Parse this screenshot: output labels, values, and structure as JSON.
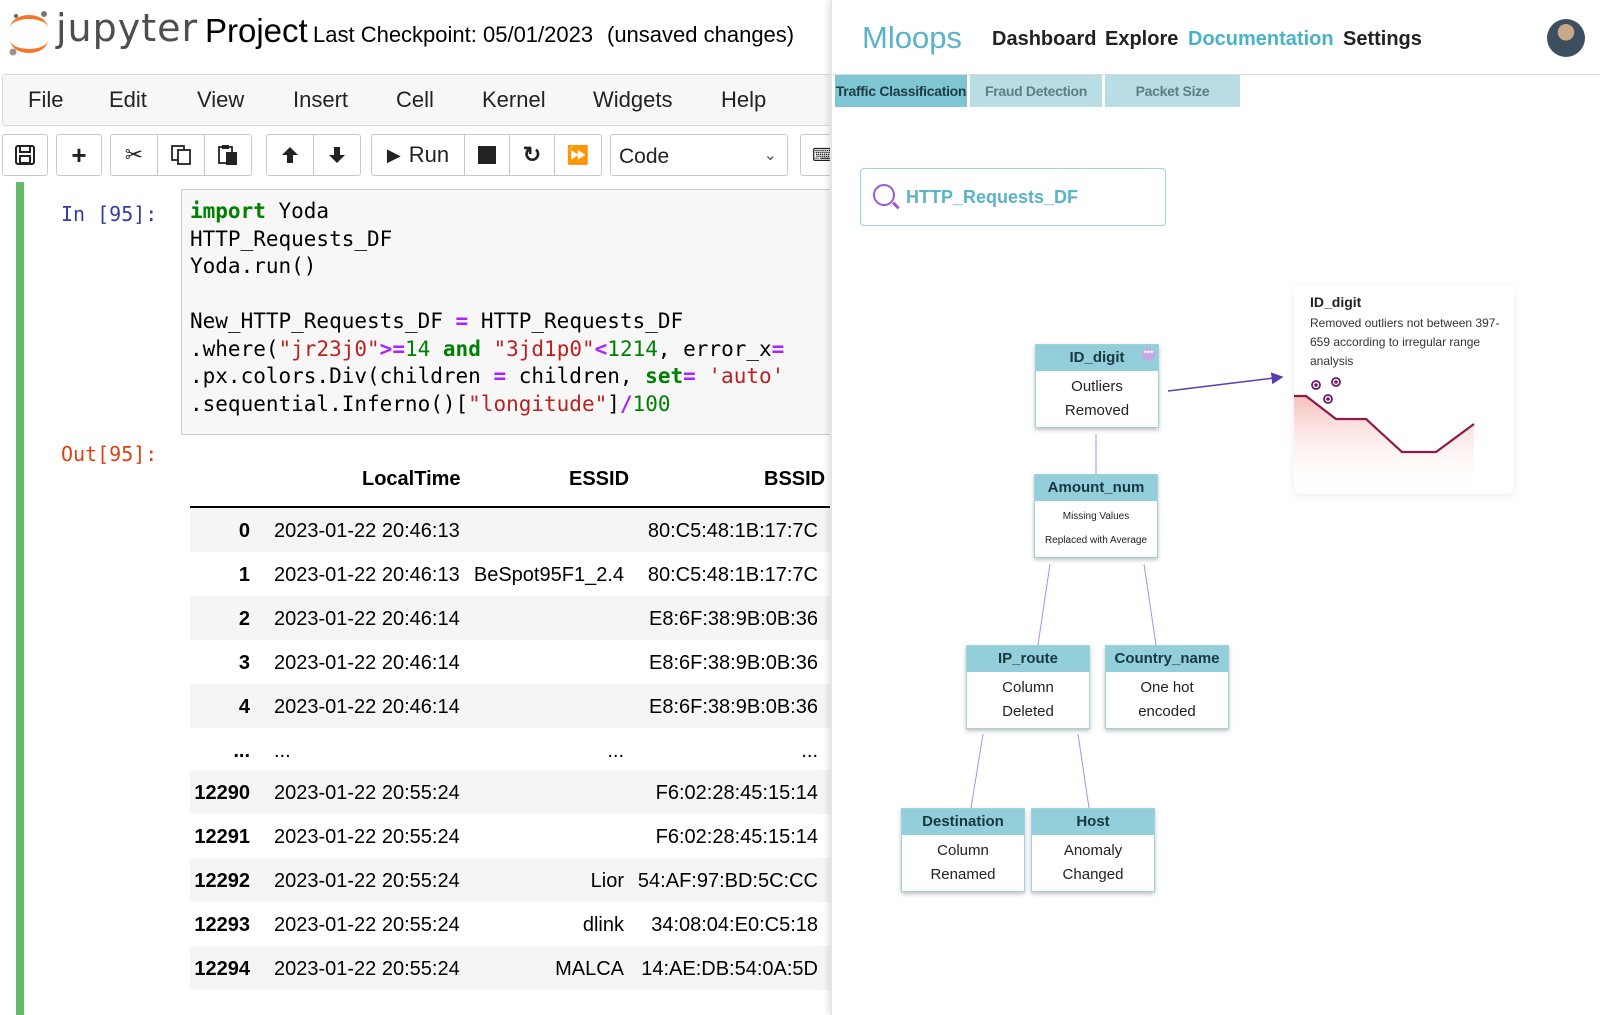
{
  "jupyter": {
    "logo_text": "jupyter",
    "notebook_title": "Project",
    "checkpoint": "Last Checkpoint: 05/01/2023",
    "unsaved": "(unsaved changes)",
    "menu": [
      "File",
      "Edit",
      "View",
      "Insert",
      "Cell",
      "Kernel",
      "Widgets",
      "Help"
    ],
    "toolbar": {
      "run_label": "Run",
      "cell_type": "Code"
    },
    "cell": {
      "in_prompt": "In [95]:",
      "out_prompt": "Out[95]:",
      "code": {
        "l1_kw": "import",
        "l1_rest": " Yoda",
        "l2": "HTTP_Requests_DF",
        "l3": "Yoda.run()",
        "l5_a": "New_HTTP_Requests_DF ",
        "l5_op": "=",
        "l5_b": " HTTP_Requests_DF",
        "l6_a": ".where(",
        "l6_s1": "\"jr23j0\"",
        "l6_op1": ">=",
        "l6_n1": "14",
        "l6_kw": " and ",
        "l6_s2": "\"3jd1p0\"",
        "l6_op2": "<",
        "l6_n2": "1214",
        "l6_b": ", error_x",
        "l6_op3": "=",
        "l7_a": ".px.colors.Div(children ",
        "l7_op1": "=",
        "l7_b": " children, ",
        "l7_kw": "set",
        "l7_op2": "=",
        "l7_s": " 'auto'",
        "l8_a": ".sequential.Inferno()[",
        "l8_s": "\"longitude\"",
        "l8_b": "]",
        "l8_op": "/",
        "l8_n": "100"
      }
    },
    "table": {
      "columns": [
        "LocalTime",
        "ESSID",
        "BSSID"
      ],
      "rows": [
        {
          "idx": "0",
          "time": "2023-01-22 20:46:13",
          "essid": "",
          "bssid": "80:C5:48:1B:17:7C"
        },
        {
          "idx": "1",
          "time": "2023-01-22 20:46:13",
          "essid": "BeSpot95F1_2.4",
          "bssid": "80:C5:48:1B:17:7C"
        },
        {
          "idx": "2",
          "time": "2023-01-22 20:46:14",
          "essid": "",
          "bssid": "E8:6F:38:9B:0B:36"
        },
        {
          "idx": "3",
          "time": "2023-01-22 20:46:14",
          "essid": "",
          "bssid": "E8:6F:38:9B:0B:36"
        },
        {
          "idx": "4",
          "time": "2023-01-22 20:46:14",
          "essid": "",
          "bssid": "E8:6F:38:9B:0B:36"
        },
        {
          "idx": "...",
          "time": "...",
          "essid": "...",
          "bssid": "..."
        },
        {
          "idx": "12290",
          "time": "2023-01-22 20:55:24",
          "essid": "",
          "bssid": "F6:02:28:45:15:14"
        },
        {
          "idx": "12291",
          "time": "2023-01-22 20:55:24",
          "essid": "",
          "bssid": "F6:02:28:45:15:14"
        },
        {
          "idx": "12292",
          "time": "2023-01-22 20:55:24",
          "essid": "Lior",
          "bssid": "54:AF:97:BD:5C:CC"
        },
        {
          "idx": "12293",
          "time": "2023-01-22 20:55:24",
          "essid": "dlink",
          "bssid": "34:08:04:E0:C5:18"
        },
        {
          "idx": "12294",
          "time": "2023-01-22 20:55:24",
          "essid": "MALCA",
          "bssid": "14:AE:DB:54:0A:5D"
        }
      ]
    }
  },
  "mloops": {
    "logo": "Mloops",
    "nav": [
      "Dashboard",
      "Explore",
      "Documentation",
      "Settings"
    ],
    "active_nav": "Documentation",
    "tabs": [
      "Traffic Classification",
      "Fraud Detection",
      "Packet Size"
    ],
    "active_tab": "Traffic Classification",
    "search_value": "HTTP_Requests_DF",
    "nodes": {
      "id_digit": {
        "title": "ID_digit",
        "l1": "Outliers",
        "l2": "Removed"
      },
      "amount_num": {
        "title": "Amount_num",
        "l1": "Missing Values",
        "l2": "Replaced with Average"
      },
      "ip_route": {
        "title": "IP_route",
        "l1": "Column",
        "l2": "Deleted"
      },
      "country_name": {
        "title": "Country_name",
        "l1": "One hot",
        "l2": "encoded"
      },
      "destination": {
        "title": "Destination",
        "l1": "Column",
        "l2": "Renamed"
      },
      "host": {
        "title": "Host",
        "l1": "Anomaly",
        "l2": "Changed"
      }
    },
    "tooltip": {
      "title": "ID_digit",
      "description": "Removed outliers not between 397-659 according to irregular range analysis"
    },
    "colors": {
      "accent": "#47b2c8",
      "node_header": "#93cfda",
      "link": "#b48ee0",
      "spark": "#8a1a4a"
    }
  }
}
